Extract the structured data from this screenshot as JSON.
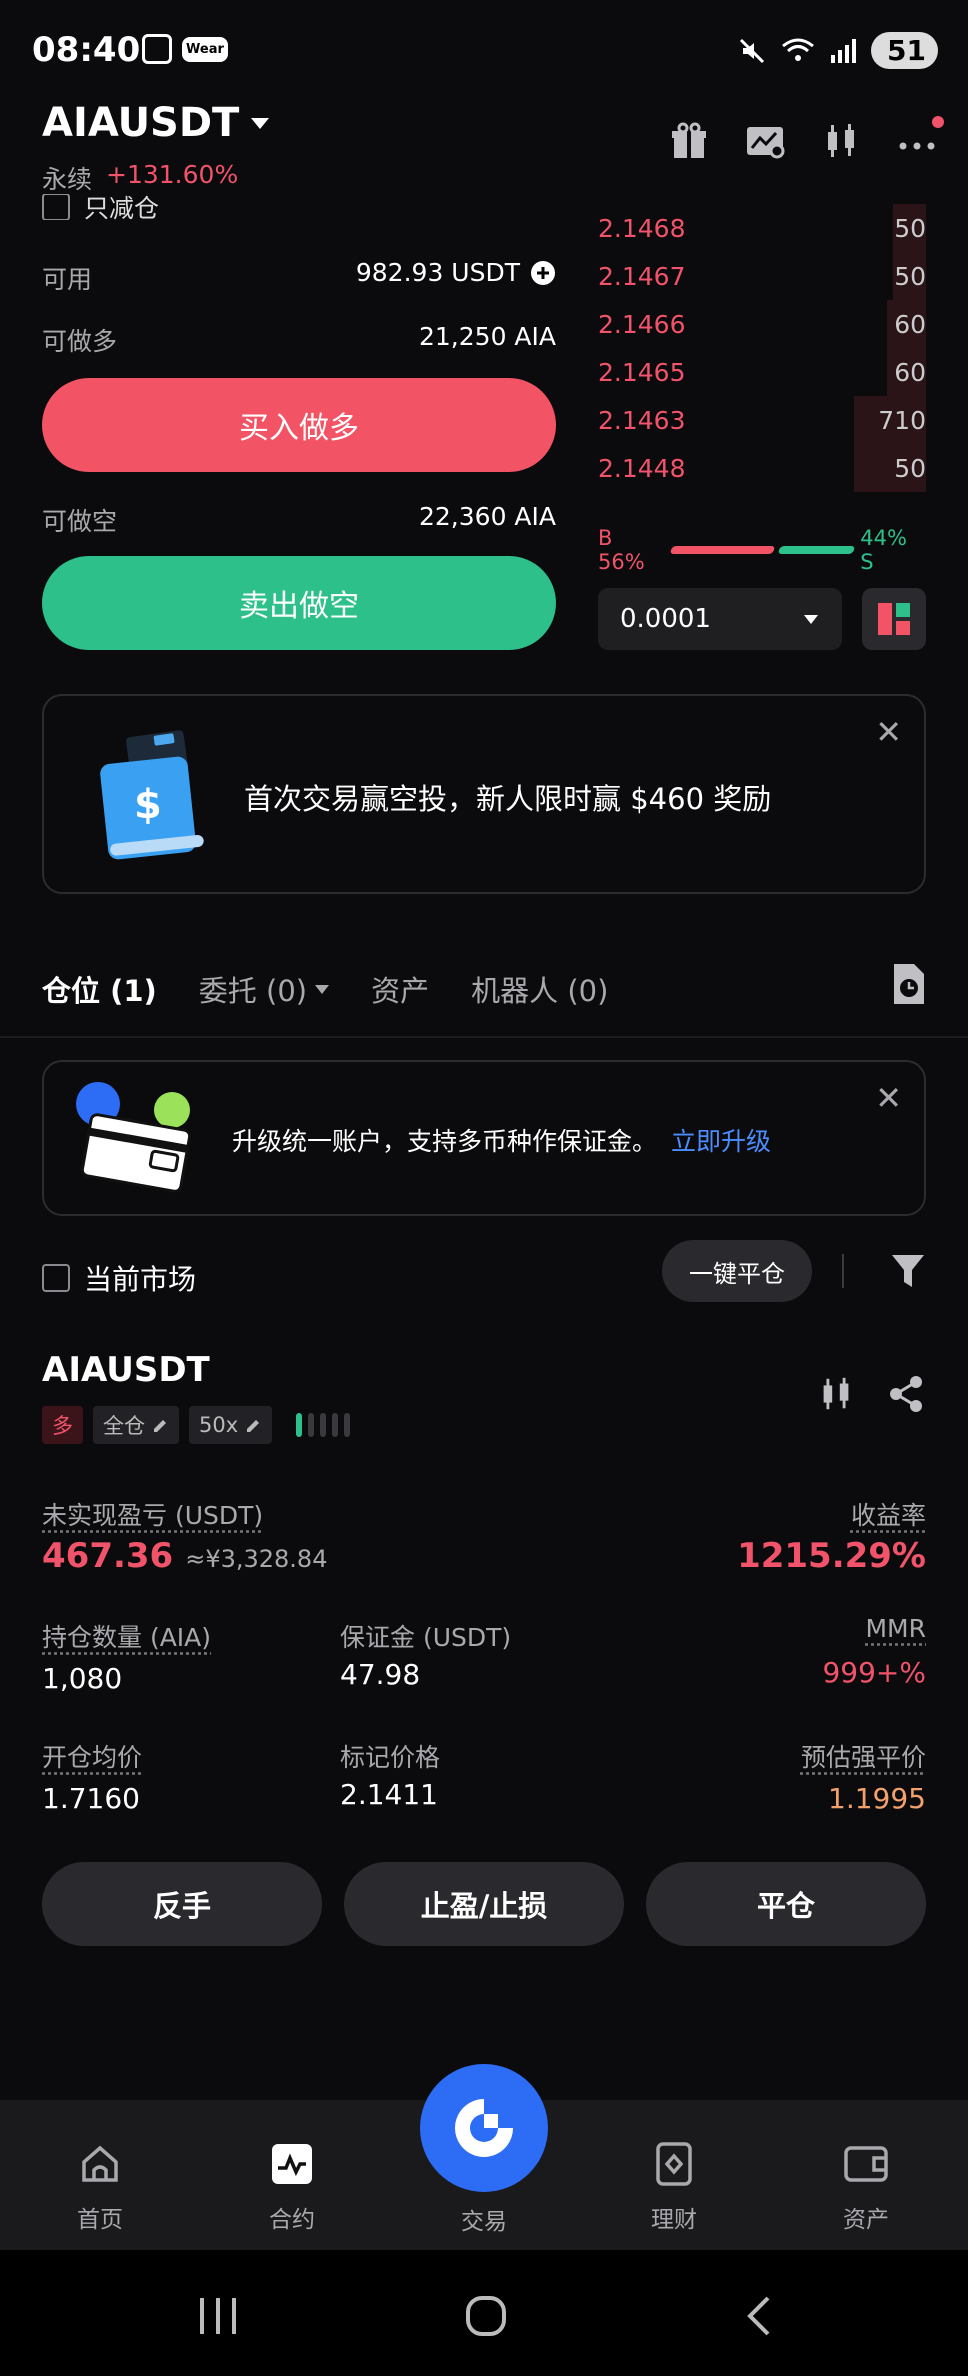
{
  "status_bar": {
    "time": "08:40",
    "wear_label": "Wear",
    "battery": "51"
  },
  "header": {
    "pair": "AIAUSDT",
    "perp_label": "永续",
    "change": "+131.60%"
  },
  "order_form": {
    "reduce_only_label": "只减仓",
    "available_label": "可用",
    "available_value": "982.93  USDT",
    "can_long_label": "可做多",
    "can_long_value": "21,250 AIA",
    "buy_button": "买入做多",
    "can_short_label": "可做空",
    "can_short_value": "22,360 AIA",
    "sell_button": "卖出做空"
  },
  "order_book": {
    "asks": [
      {
        "price": "2.1468",
        "size": "50",
        "depth": 0.1
      },
      {
        "price": "2.1467",
        "size": "50",
        "depth": 0.1
      },
      {
        "price": "2.1466",
        "size": "60",
        "depth": 0.12
      },
      {
        "price": "2.1465",
        "size": "60",
        "depth": 0.12
      },
      {
        "price": "2.1463",
        "size": "710",
        "depth": 0.22
      },
      {
        "price": "2.1448",
        "size": "50",
        "depth": 0.22
      }
    ],
    "buy_ratio_label": "B 56%",
    "sell_ratio_label": "44% S",
    "precision": "0.0001"
  },
  "promo": {
    "text": "首次交易赢空投，新人限时赢 $460 奖励"
  },
  "tabs": [
    {
      "label": "仓位 (1)"
    },
    {
      "label": "委托 (0)"
    },
    {
      "label": "资产"
    },
    {
      "label": "机器人 (0)"
    }
  ],
  "upgrade_banner": {
    "text": "升级统一账户，支持多币种作保证金。",
    "link": "立即升级"
  },
  "filter": {
    "current_market_label": "当前市场",
    "close_all_button": "一键平仓"
  },
  "position": {
    "symbol": "AIAUSDT",
    "side_tag": "多",
    "margin_mode_tag": "全仓",
    "leverage_tag": "50x",
    "unrealized_pnl_label": "未实现盈亏 (USDT)",
    "unrealized_pnl_value": "467.36",
    "unrealized_pnl_cny": "≈¥3,328.84",
    "roe_label": "收益率",
    "roe_value": "1215.29%",
    "size_label": "持仓数量 (AIA)",
    "size_value": "1,080",
    "margin_label": "保证金 (USDT)",
    "margin_value": "47.98",
    "mmr_label": "MMR",
    "mmr_value": "999+%",
    "entry_label": "开仓均价",
    "entry_value": "1.7160",
    "mark_label": "标记价格",
    "mark_value": "2.1411",
    "liq_label": "预估强平价",
    "liq_value": "1.1995",
    "reverse_button": "反手",
    "tpsl_button": "止盈/止损",
    "close_button": "平仓"
  },
  "bottom_nav": {
    "home": "首页",
    "futures": "合约",
    "trade": "交易",
    "earn": "理财",
    "assets": "资产"
  },
  "colors": {
    "red": "#f25466",
    "green": "#2ec08b",
    "blue": "#2d6cf5",
    "link": "#4b8dff"
  }
}
